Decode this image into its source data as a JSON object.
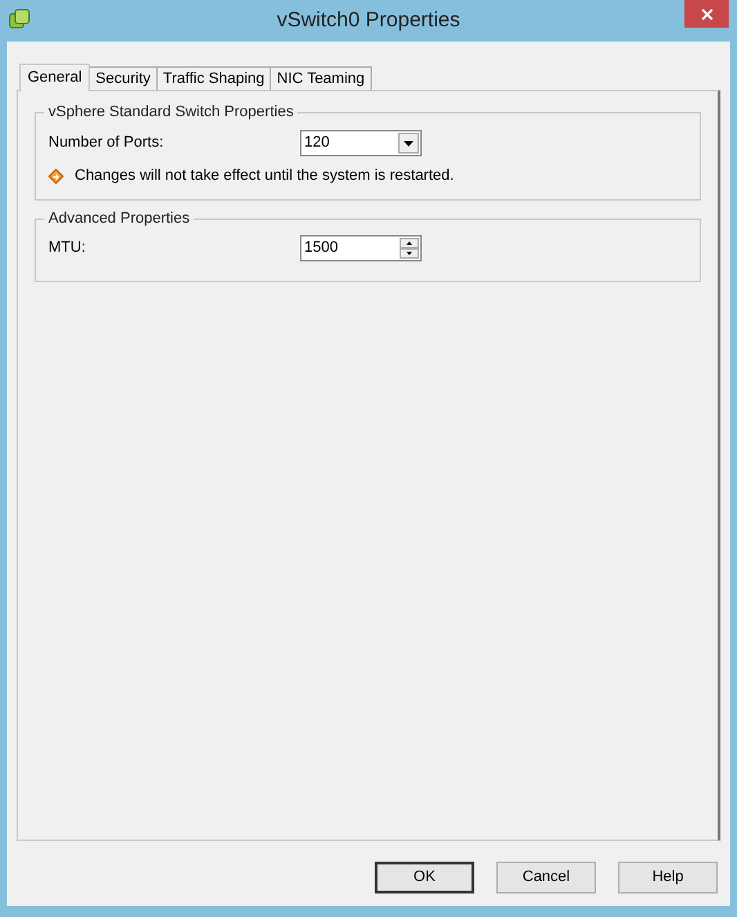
{
  "window": {
    "title": "vSwitch0 Properties"
  },
  "tabs": [
    {
      "label": "General",
      "selected": true
    },
    {
      "label": "Security",
      "selected": false
    },
    {
      "label": "Traffic Shaping",
      "selected": false
    },
    {
      "label": "NIC Teaming",
      "selected": false
    }
  ],
  "switch_group": {
    "title": "vSphere Standard Switch Properties",
    "ports_label": "Number of Ports:",
    "ports_value": "120",
    "warning": "Changes will not take effect until the system is restarted."
  },
  "advanced_group": {
    "title": "Advanced Properties",
    "mtu_label": "MTU:",
    "mtu_value": "1500"
  },
  "buttons": [
    {
      "label": "OK",
      "default": true
    },
    {
      "label": "Cancel",
      "default": false
    },
    {
      "label": "Help",
      "default": false
    }
  ]
}
